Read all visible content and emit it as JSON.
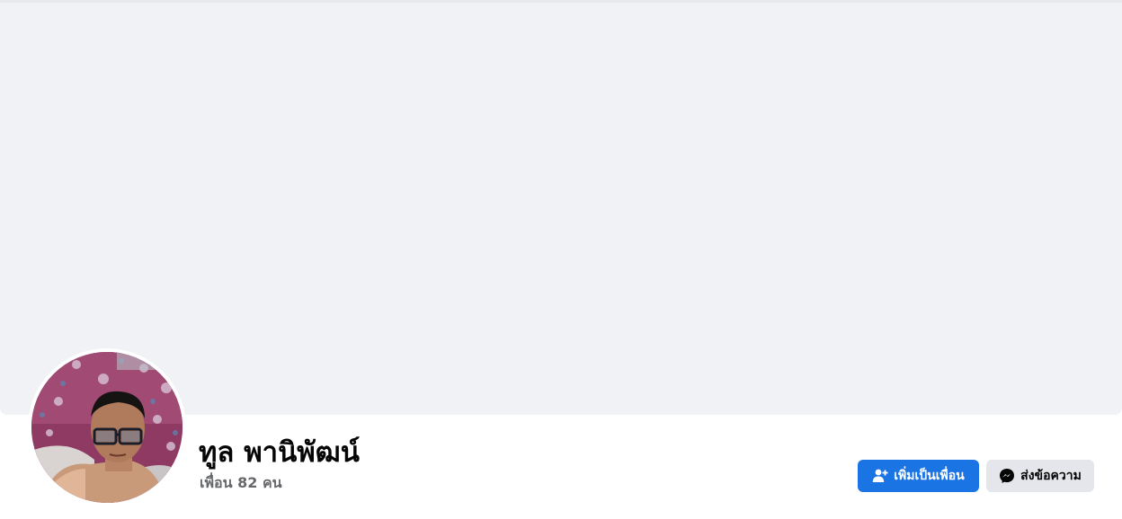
{
  "profile": {
    "name": "ทูล พานิพัฒน์",
    "friends_text": "เพื่อน 82 คน"
  },
  "actions": {
    "add_friend_label": "เพิ่มเป็นเพื่อน",
    "message_label": "ส่งข้อความ"
  },
  "icons": {
    "add_friend": "user-plus-icon",
    "message": "messenger-icon"
  },
  "colors": {
    "cover_bg": "#f0f2f5",
    "primary_button": "#1b74e4",
    "secondary_button": "#e4e6eb",
    "name_text": "#050505",
    "secondary_text": "#65676b"
  }
}
